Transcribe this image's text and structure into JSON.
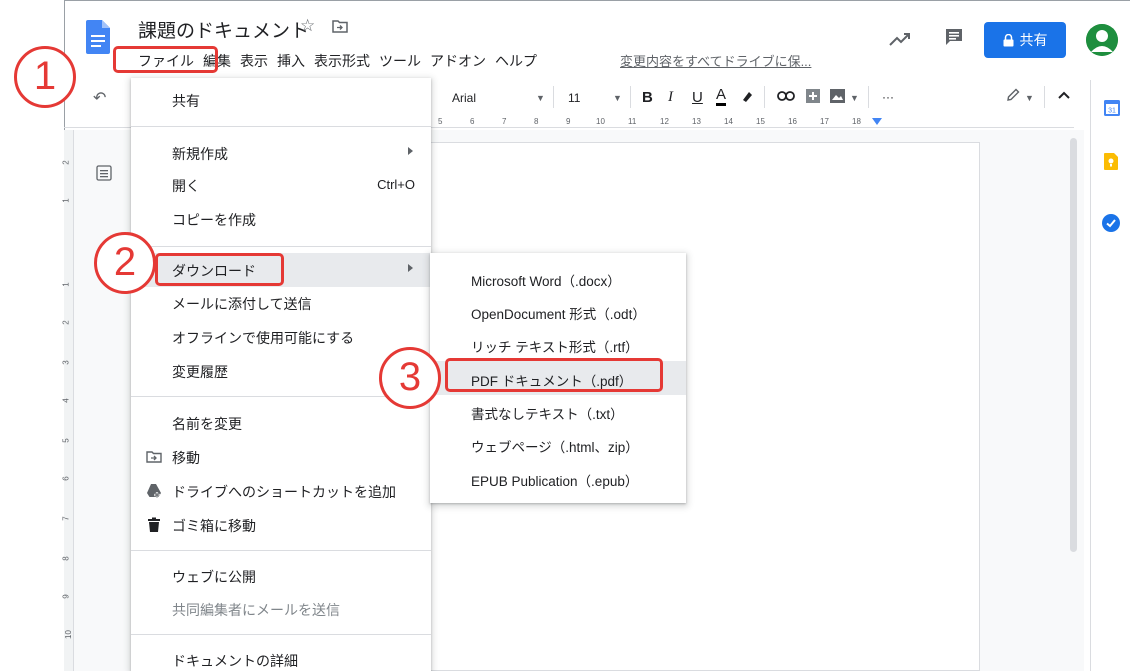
{
  "doc": {
    "title": "課題のドキュメント",
    "save_status": "変更内容をすべてドライブに保..."
  },
  "menubar": [
    "ファイル",
    "編集",
    "表示",
    "挿入",
    "表示形式",
    "ツール",
    "アドオン",
    "ヘルプ"
  ],
  "header": {
    "share_label": "共有"
  },
  "toolbar": {
    "font": "Arial",
    "font_size": "11",
    "bold": "B",
    "italic": "I",
    "underline": "U",
    "text_color": "A",
    "more": "···"
  },
  "ruler": {
    "h_marks": [
      "5",
      "6",
      "7",
      "8",
      "9",
      "10",
      "11",
      "12",
      "13",
      "14",
      "15",
      "16",
      "17",
      "18"
    ],
    "v_marks": [
      "2",
      "1",
      "1",
      "2",
      "3",
      "4",
      "5",
      "6",
      "7",
      "8",
      "9",
      "10"
    ]
  },
  "file_menu": {
    "items": [
      {
        "label": "共有",
        "shortcut": "",
        "submenu": false
      },
      {
        "label": "新規作成",
        "shortcut": "",
        "submenu": true
      },
      {
        "label": "開く",
        "shortcut": "Ctrl+O",
        "submenu": false
      },
      {
        "label": "コピーを作成",
        "shortcut": "",
        "submenu": false
      },
      {
        "label": "ダウンロード",
        "shortcut": "",
        "submenu": true
      },
      {
        "label": "メールに添付して送信",
        "shortcut": "",
        "submenu": false
      },
      {
        "label": "オフラインで使用可能にする",
        "shortcut": "",
        "submenu": false
      },
      {
        "label": "変更履歴",
        "shortcut": "",
        "submenu": true
      },
      {
        "label": "名前を変更",
        "shortcut": "",
        "submenu": false
      },
      {
        "label": "移動",
        "shortcut": "",
        "submenu": false,
        "icon": "folder-move-icon"
      },
      {
        "label": "ドライブへのショートカットを追加",
        "shortcut": "",
        "submenu": false,
        "icon": "drive-shortcut-icon"
      },
      {
        "label": "ゴミ箱に移動",
        "shortcut": "",
        "submenu": false,
        "icon": "trash-icon"
      },
      {
        "label": "ウェブに公開",
        "shortcut": "",
        "submenu": false
      },
      {
        "label": "共同編集者にメールを送信",
        "shortcut": "",
        "submenu": false,
        "disabled": true
      },
      {
        "label": "ドキュメントの詳細",
        "shortcut": "",
        "submenu": false
      }
    ]
  },
  "download_submenu": {
    "items": [
      "Microsoft Word（.docx）",
      "OpenDocument 形式（.odt）",
      "リッチ テキスト形式（.rtf）",
      "PDF ドキュメント（.pdf）",
      "書式なしテキスト（.txt）",
      "ウェブページ（.html、zip）",
      "EPUB Publication（.epub）"
    ]
  },
  "annotations": {
    "steps": [
      "1",
      "2",
      "3"
    ],
    "color": "#e53935"
  },
  "colors": {
    "accent": "#1a73e8",
    "avatar": "#1e8e3e"
  }
}
